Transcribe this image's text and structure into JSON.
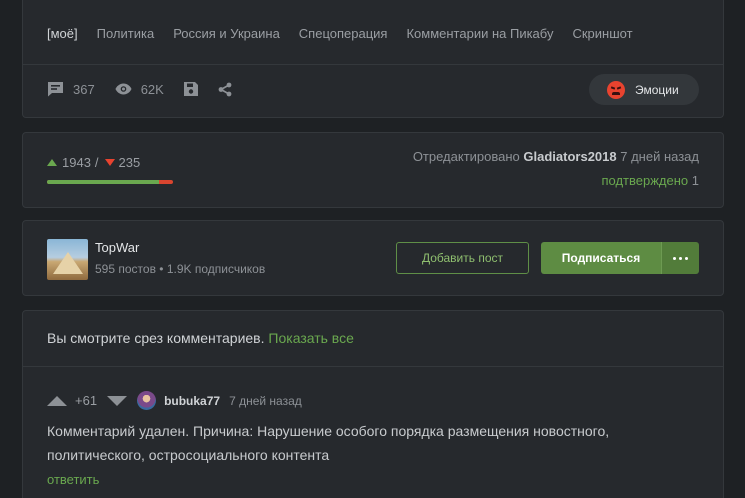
{
  "post": {
    "tags": [
      "[моё]",
      "Политика",
      "Россия и Украина",
      "Спецоперация",
      "Комментарии на Пикабу",
      "Скриншот"
    ],
    "actions": {
      "comments_count": "367",
      "views_count": "62K"
    },
    "emotions_label": "Эмоции"
  },
  "rating": {
    "upvotes": "1943",
    "separator": "/",
    "downvotes": "235",
    "positive_fraction": 0.892,
    "edited_prefix": "Отредактировано",
    "edited_by": "Gladiators2018",
    "edited_when": "7 дней назад",
    "confirmed_label": "подтверждено",
    "confirmed_count": "1"
  },
  "community": {
    "name": "TopWar",
    "posts": "595 постов",
    "bullet": "•",
    "subscribers": "1.9K подписчиков",
    "add_post_label": "Добавить пост",
    "subscribe_label": "Подписаться"
  },
  "comments": {
    "slice_note": "Вы смотрите срез комментариев.",
    "show_all_label": "Показать все",
    "items": [
      {
        "score": "+61",
        "user": "bubuka77",
        "time": "7 дней назад",
        "body": "Комментарий удален. Причина: Нарушение особого порядка размещения новостного, политического, остросоциального контента",
        "reply_label": "ответить"
      }
    ]
  },
  "colors": {
    "accent_green": "#6aa84f",
    "accent_red": "#e8432f",
    "card_bg": "#26292d",
    "page_bg": "#1e2124"
  }
}
